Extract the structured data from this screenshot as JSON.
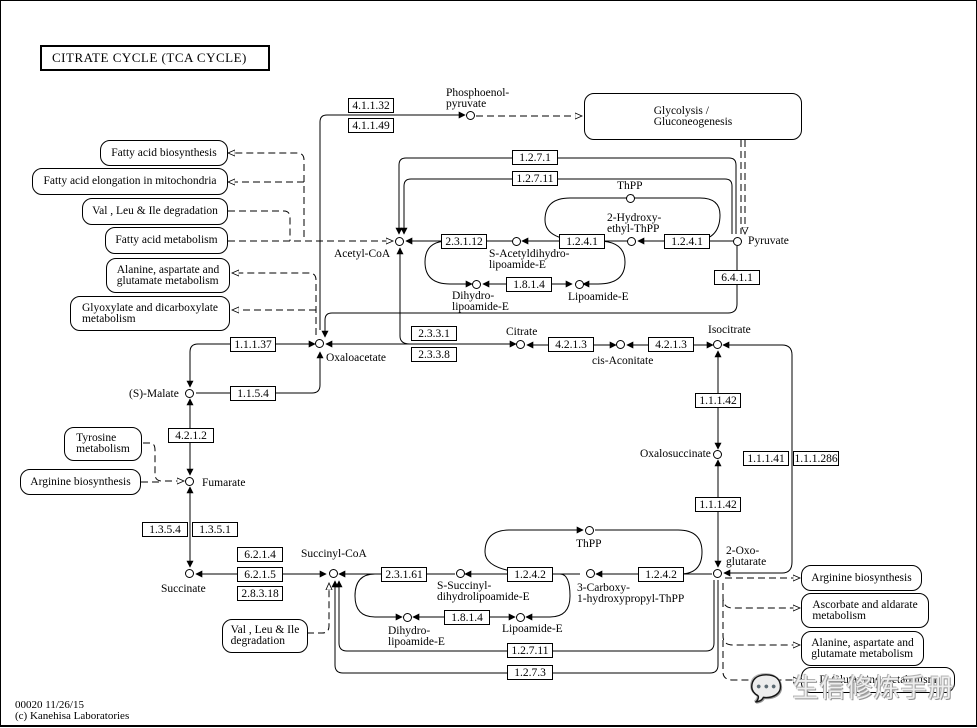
{
  "title": "CITRATE  CYCLE  (TCA CYCLE)",
  "footer": {
    "line1": "00020 11/26/15",
    "line2": "(c) Kanehisa Laboratories"
  },
  "watermark": {
    "icon": "wechat-icon",
    "text": "生信修炼手册"
  },
  "maps": {
    "glycolysis": "Glycolysis /\nGluconeogenesis",
    "fatty_acid_biosynthesis": "Fatty acid biosynthesis",
    "fatty_acid_elongation": "Fatty acid elongation in mitochondria",
    "val_leu_ile_top": "Val , Leu & Ile degradation",
    "fatty_acid_metabolism": "Fatty acid metabolism",
    "alanine_top": "Alanine, aspartate and\nglutamate metabolism",
    "glyoxylate": "Glyoxylate and dicarboxylate\nmetabolism",
    "tyrosine": "Tyrosine\nmetabolism",
    "arginine_left": "Arginine biosynthesis",
    "val_leu_ile_bottom": "Val , Leu & Ile\ndegradation",
    "arginine_right": "Arginine biosynthesis",
    "ascorbate": "Ascorbate and aldarate\nmetabolism",
    "alanine_bottom": "Alanine, aspartate and\nglutamate metabolism",
    "d_glutamine": "D-Glutamine metabolism"
  },
  "compounds": {
    "pep": "Phosphoenol-\npyruvate",
    "pyruvate": "Pyruvate",
    "acetyl_coa": "Acetyl-CoA",
    "thpp_top": "ThPP",
    "hydroxyethyl_thpp": "2-Hydroxy-\nethyl-ThPP",
    "s_acetyldihydro": "S-Acetyldihydro-\nlipoamide-E",
    "dihydrolipoamide_top": "Dihydro-\nlipoamide-E",
    "lipoamide_top": "Lipoamide-E",
    "oxaloacetate": "Oxaloacetate",
    "citrate": "Citrate",
    "cis_aconitate": "cis-Aconitate",
    "isocitrate": "Isocitrate",
    "oxalosuccinate": "Oxalosuccinate",
    "malate": "(S)-Malate",
    "fumarate": "Fumarate",
    "succinate": "Succinate",
    "succinyl_coa": "Succinyl-CoA",
    "oxoglutarate": "2-Oxo-\nglutarate",
    "thpp_bottom": "ThPP",
    "s_succinyl": "S-Succinyl-\ndihydrolipoamide-E",
    "carboxy_thpp": "3-Carboxy-\n1-hydroxypropyl-ThPP",
    "dihydrolipoamide_bottom": "Dihydro-\nlipoamide-E",
    "lipoamide_bottom": "Lipoamide-E"
  },
  "enzymes": {
    "e4_1_1_32": "4.1.1.32",
    "e4_1_1_49": "4.1.1.49",
    "e1_2_7_1": "1.2.7.1",
    "e1_2_7_11_top": "1.2.7.11",
    "e2_3_1_12": "2.3.1.12",
    "e1_2_4_1_a": "1.2.4.1",
    "e1_2_4_1_b": "1.2.4.1",
    "e1_8_1_4_top": "1.8.1.4",
    "e6_4_1_1": "6.4.1.1",
    "e2_3_3_1": "2.3.3.1",
    "e2_3_3_8": "2.3.3.8",
    "e4_2_1_3_a": "4.2.1.3",
    "e4_2_1_3_b": "4.2.1.3",
    "e1_1_1_37": "1.1.1.37",
    "e1_1_5_4": "1.1.5.4",
    "e4_2_1_2": "4.2.1.2",
    "e1_1_1_42_a": "1.1.1.42",
    "e1_1_1_42_b": "1.1.1.42",
    "e1_1_1_41": "1.1.1.41",
    "e1_1_1_286": "1.1.1.286",
    "e1_3_5_4": "1.3.5.4",
    "e1_3_5_1": "1.3.5.1",
    "e6_2_1_4": "6.2.1.4",
    "e6_2_1_5": "6.2.1.5",
    "e2_8_3_18": "2.8.3.18",
    "e2_3_1_61": "2.3.1.61",
    "e1_2_4_2_a": "1.2.4.2",
    "e1_2_4_2_b": "1.2.4.2",
    "e1_8_1_4_bottom": "1.8.1.4",
    "e1_2_7_11_bottom": "1.2.7.11",
    "e1_2_7_3": "1.2.7.3"
  }
}
